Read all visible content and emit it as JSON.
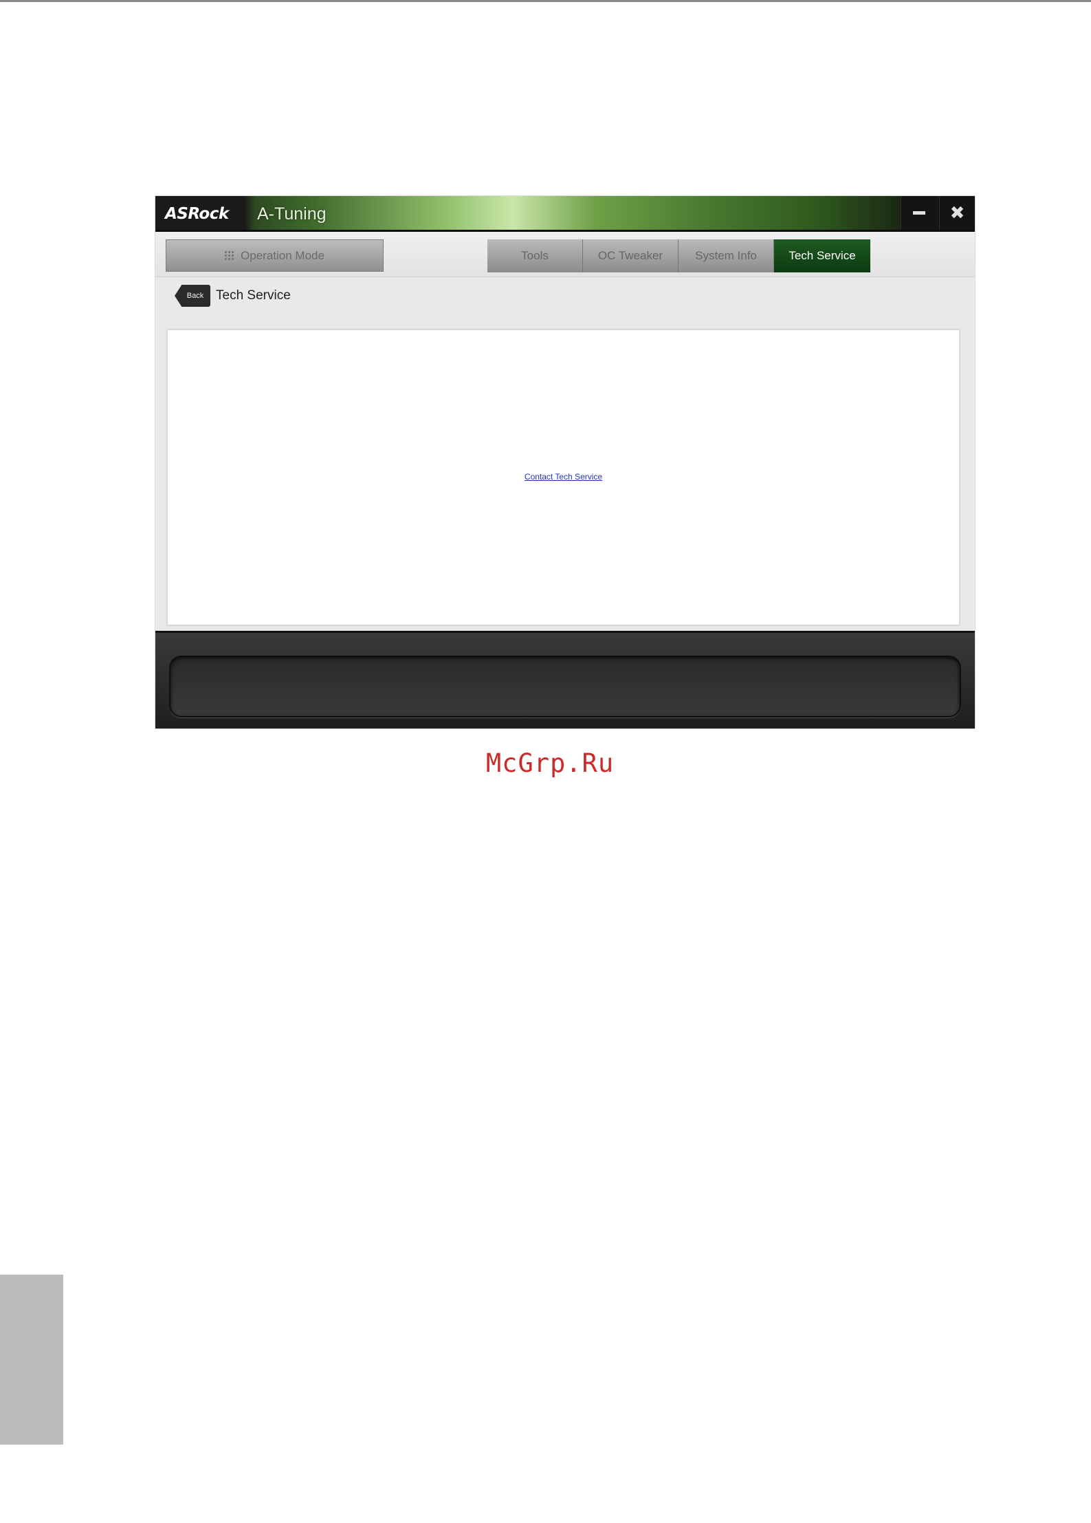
{
  "window": {
    "brand": "ASRock",
    "title": "A-Tuning",
    "minimize_icon": "minimize-icon",
    "close_icon": "close-icon",
    "close_glyph": "✖"
  },
  "nav": {
    "operation_mode_label": "Operation Mode",
    "tabs": [
      {
        "label": "Tools",
        "active": false
      },
      {
        "label": "OC Tweaker",
        "active": false
      },
      {
        "label": "System Info",
        "active": false
      },
      {
        "label": "Tech Service",
        "active": true
      }
    ]
  },
  "breadcrumb": {
    "back_label": "Back",
    "page_title": "Tech Service"
  },
  "content": {
    "link_text": "Contact Tech Service"
  },
  "watermark": {
    "text": "McGrp.Ru"
  },
  "colors": {
    "active_tab": "#0c3a10",
    "link": "#2233bb",
    "watermark": "#cc2a2a"
  }
}
